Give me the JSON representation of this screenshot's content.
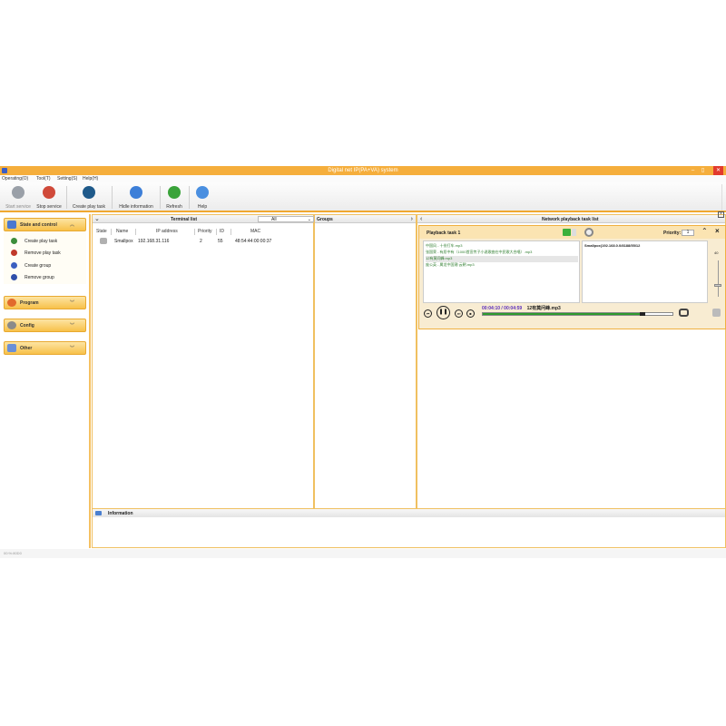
{
  "window": {
    "title": "Digital net IP(PA+VA) system",
    "minimize": "–",
    "maximize": "▯",
    "close": "✕"
  },
  "menu": [
    "Operating(O)",
    "Tool(T)",
    "Setting(S)",
    "Help(H)"
  ],
  "toolbar": {
    "start_service": "Start service",
    "stop_service": "Stop service",
    "create_play_task": "Create play task",
    "hide_information": "Hidle information",
    "refresh": "Refresh",
    "help": "Help"
  },
  "sidebar": {
    "state_control": {
      "label": "State and control",
      "items": [
        "Create play task",
        "Remove play task",
        "Create group",
        "Remove group"
      ]
    },
    "program": "Program",
    "config": "Config",
    "other": "Other"
  },
  "terminal": {
    "title": "Terminal list",
    "filter": "All",
    "columns": [
      "State",
      "Name",
      "IP address",
      "Priority",
      "ID",
      "MAC"
    ],
    "rows": [
      {
        "name": "Smallpox",
        "ip": "192.168.31.116",
        "priority": "2",
        "id": "55",
        "mac": "48:54:44:00:00:37"
      }
    ]
  },
  "groups": {
    "title": "Groups"
  },
  "network": {
    "title": "Network playback task list",
    "task": {
      "name": "Playback task 1",
      "priority_label": "Priority:",
      "priority": "1",
      "songs": [
        "中国风 - 十份打车.mp3",
        "张国荣 - 有愿中有（1000首宣传子小说歌曲在中民歌大合唱）.mp3",
        "12有莫问峰.mp3",
        "庞公英 - 属龙中国潮 云朝.mp3"
      ],
      "selected_song": 2,
      "target": "Smallpox(192.168.0.0/8188/55/12",
      "volume": "40",
      "volume_level": 0.35,
      "time": "00:04:10 / 00:04:59",
      "file": "12有莫问峰.mp3",
      "progress": 0.84
    }
  },
  "information": {
    "label": "Information"
  },
  "status": {
    "text": "00:%:80D0"
  }
}
